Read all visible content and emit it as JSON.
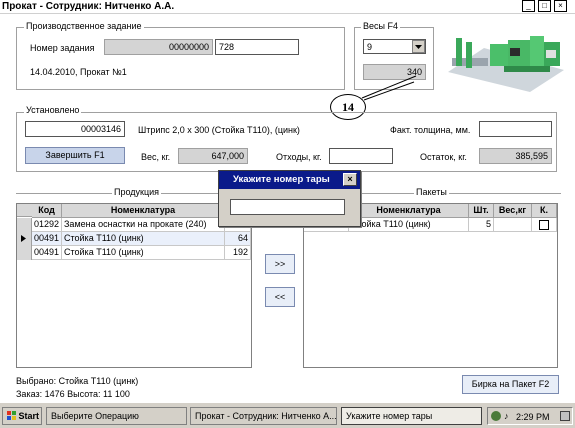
{
  "window": {
    "title": "Прокат - Сотрудник: Нитченко А.А.",
    "minimize": "_",
    "maximize": "□",
    "close": "×"
  },
  "production": {
    "group_label": "Производственное задание",
    "order_label": "Номер задания",
    "order_value": "00000000",
    "order_extra": "728",
    "date_line": "14.04.2010, Прокат №1"
  },
  "scales": {
    "group_label": "Весы  F4",
    "selected": "9",
    "reading": "340"
  },
  "callout": {
    "number": "14"
  },
  "installed": {
    "group_label": "Установлено",
    "code": "00003146",
    "description": "Штрипс 2,0 х 300 (Стойка Т110), (цинк)",
    "thickness_label": "Факт. толщина, мм.",
    "thickness_value": "",
    "finish_button": "Завершить    F1",
    "weight_label": "Вес, кг.",
    "weight_value": "647,000",
    "waste_label": "Отходы, кг.",
    "waste_value": "",
    "remainder_label": "Остаток, кг.",
    "remainder_value": "385,595"
  },
  "products": {
    "group_label": "Продукция",
    "columns": [
      "Код",
      "Номенклатура",
      ""
    ],
    "rows": [
      {
        "code": "01292",
        "name": "Замена оснастки на прокате (240)",
        "qty": ""
      },
      {
        "code": "00491",
        "name": "Стойка Т110 (цинк)",
        "qty": "64"
      },
      {
        "code": "00491",
        "name": "Стойка Т110 (цинк)",
        "qty": "192"
      }
    ]
  },
  "move_buttons": {
    "forward": ">>",
    "back": "<<"
  },
  "packages": {
    "group_label": "Пакеты",
    "columns": [
      "Номенклатура",
      "Шт.",
      "Вес,кг",
      "К."
    ],
    "rows": [
      {
        "name": "Стойка Т110 (цинк)",
        "qty": "5",
        "weight": ""
      }
    ]
  },
  "dialog": {
    "title": "Укажите номер тары",
    "close": "×",
    "value": ""
  },
  "footer": {
    "selected": "Выбрано: Стойка Т110 (цинк)",
    "order_info": "Заказ: 1476  Высота: 11 100",
    "tag_button": "Бирка на Пакет   F2"
  },
  "taskbar": {
    "start": "Start",
    "items": [
      "Выберите Операцию",
      "Прокат - Сотрудник: Нитченко А...",
      "Укажите номер тары"
    ],
    "clock": "2:29 PM"
  },
  "colors": {
    "dialog_title": "#0a1a8a",
    "button": "#c8d4ea",
    "readonly": "#d4d4d4",
    "taskbar": "#d4d0c8"
  }
}
